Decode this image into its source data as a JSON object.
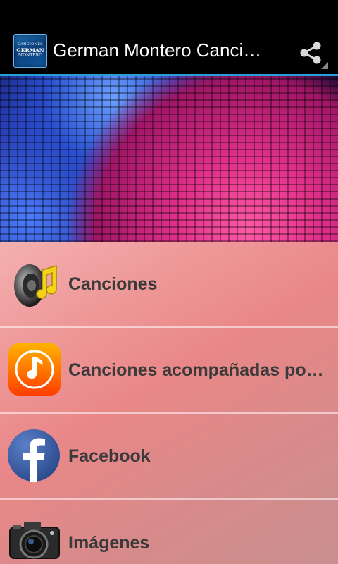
{
  "app": {
    "title": "German Montero Canci…"
  },
  "app_icon": {
    "line1": "CANCIONES",
    "line2": "GERMAN",
    "line3": "MONTERO"
  },
  "menu": [
    {
      "label": "Canciones",
      "icon": "speaker-music-icon"
    },
    {
      "label": "Canciones acompañadas por…",
      "icon": "music-note-icon"
    },
    {
      "label": "Facebook",
      "icon": "facebook-icon"
    },
    {
      "label": "Imágenes",
      "icon": "camera-icon"
    }
  ]
}
